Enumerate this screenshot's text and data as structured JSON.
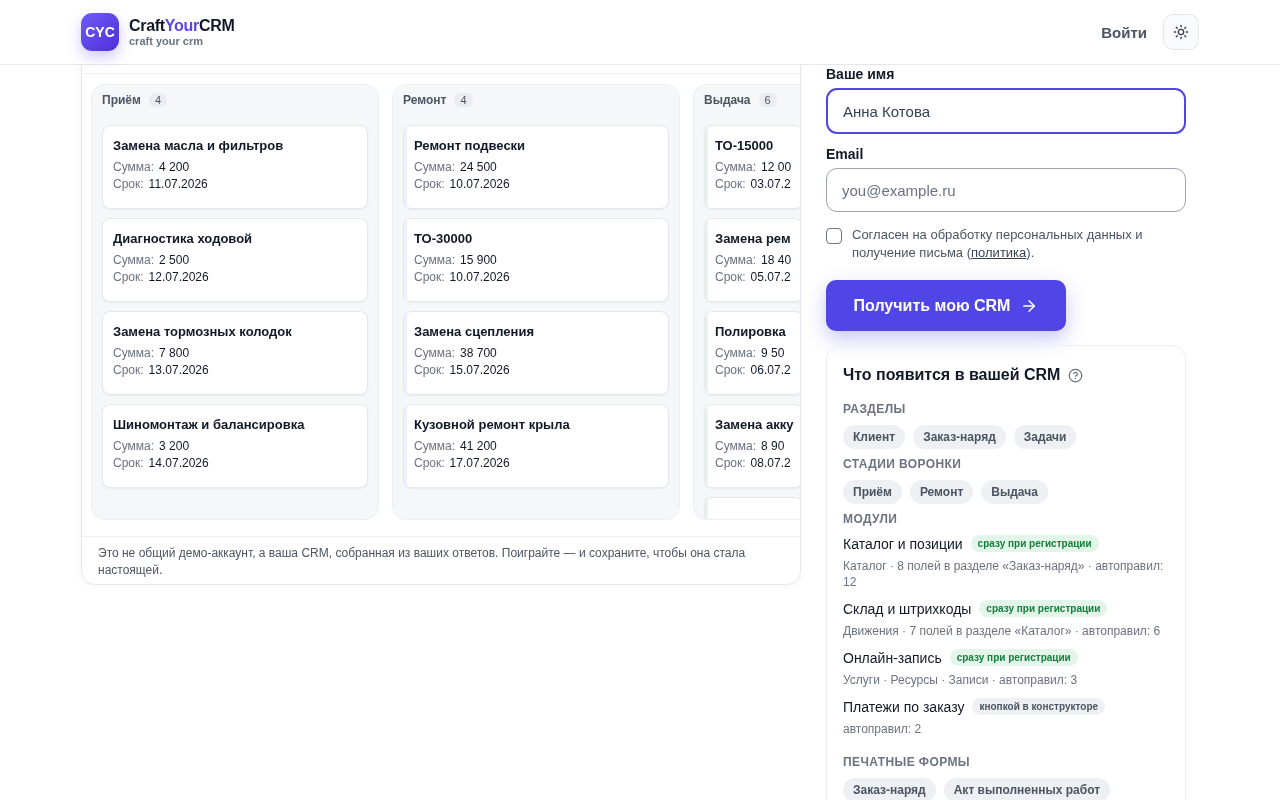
{
  "header": {
    "logo": "CYC",
    "brand": {
      "prefix": "Craft",
      "accent": "Your",
      "suffix": "CRM"
    },
    "tagline": "craft your crm",
    "login": "Войти"
  },
  "board": {
    "columns": [
      {
        "title": "Приём",
        "count": "4",
        "cards": [
          {
            "title": "Замена масла и фильтров",
            "sum_label": "Сумма:",
            "sum": "4 200",
            "due_label": "Срок:",
            "due": "11.07.2026"
          },
          {
            "title": "Диагностика ходовой",
            "sum_label": "Сумма:",
            "sum": "2 500",
            "due_label": "Срок:",
            "due": "12.07.2026"
          },
          {
            "title": "Замена тормозных колодок",
            "sum_label": "Сумма:",
            "sum": "7 800",
            "due_label": "Срок:",
            "due": "13.07.2026"
          },
          {
            "title": "Шиномонтаж и балансировка",
            "sum_label": "Сумма:",
            "sum": "3 200",
            "due_label": "Срок:",
            "due": "14.07.2026"
          }
        ],
        "cut_off": false
      },
      {
        "title": "Ремонт",
        "count": "4",
        "color": "#eef0fb",
        "cards": [
          {
            "title": "Ремонт подвески",
            "sum_label": "Сумма:",
            "sum": "24 500",
            "due_label": "Срок:",
            "due": "10.07.2026"
          },
          {
            "title": "ТО-30000",
            "sum_label": "Сумма:",
            "sum": "15 900",
            "due_label": "Срок:",
            "due": "10.07.2026"
          },
          {
            "title": "Замена сцепления",
            "sum_label": "Сумма:",
            "sum": "38 700",
            "due_label": "Срок:",
            "due": "15.07.2026"
          },
          {
            "title": "Кузовной ремонт крыла",
            "sum_label": "Сумма:",
            "sum": "41 200",
            "due_label": "Срок:",
            "due": "17.07.2026"
          }
        ],
        "cut_off": false
      },
      {
        "title": "Выдача",
        "count": "6",
        "color": "#e6f4ea",
        "cards": [
          {
            "title": "ТО-15000",
            "sum_label": "Сумма:",
            "sum": "12 00",
            "due_label": "Срок:",
            "due": "03.07.2"
          },
          {
            "title": "Замена рем",
            "sum_label": "Сумма:",
            "sum": "18 40",
            "due_label": "Срок:",
            "due": "05.07.2"
          },
          {
            "title": "Полировка",
            "sum_label": "Сумма:",
            "sum": "9 50",
            "due_label": "Срок:",
            "due": "06.07.2"
          },
          {
            "title": "Замена акку",
            "sum_label": "Сумма:",
            "sum": "8 90",
            "due_label": "Срок:",
            "due": "08.07.2"
          }
        ],
        "cut_off": true
      }
    ],
    "note": "Это не общий демо-аккаунт, а ваша CRM, собранная из ваших ответов. Поиграйте — и сохраните, чтобы она стала настоящей."
  },
  "form": {
    "name_label": "Ваше имя",
    "name_value": "Анна Котова",
    "name_focused": true,
    "email_label": "Email",
    "email_placeholder": "you@example.ru",
    "consent_checked": false,
    "consent_text": "Согласен на обработку персональных данных и получение письма (",
    "consent_link": "политика",
    "consent_end": ").",
    "submit": "Получить мою CRM"
  },
  "preview": {
    "title": "Что появится в вашей CRM",
    "sections": [
      {
        "kind": "chips",
        "heading": "РАЗДЕЛЫ",
        "items": [
          "Клиент",
          "Заказ-наряд",
          "Задачи"
        ]
      },
      {
        "kind": "chips",
        "heading": "СТАДИИ ВОРОНКИ",
        "items": [
          "Приём",
          "Ремонт",
          "Выдача"
        ]
      },
      {
        "kind": "modules",
        "heading": "МОДУЛИ",
        "modules": [
          {
            "name": "Каталог и позиции",
            "badge": "сразу при регистрации",
            "kind": "instant",
            "details": "Каталог · 8 полей в разделе «Заказ-наряд» · автоправил: 12"
          },
          {
            "name": "Склад и штрихкоды",
            "badge": "сразу при регистрации",
            "kind": "instant",
            "details": "Движения · 7 полей в разделе «Каталог» · автоправил: 6"
          },
          {
            "name": "Онлайн-запись",
            "badge": "сразу при регистрации",
            "kind": "instant",
            "details": "Услуги · Ресурсы · Записи · автоправил: 3"
          },
          {
            "name": "Платежи по заказу",
            "badge": "кнопкой в конструкторе",
            "kind": "manual",
            "details": "автоправил: 2"
          }
        ]
      },
      {
        "kind": "chips",
        "heading": "ПЕЧАТНЫЕ ФОРМЫ",
        "items": [
          "Заказ-наряд",
          "Акт выполненных работ"
        ]
      }
    ]
  }
}
